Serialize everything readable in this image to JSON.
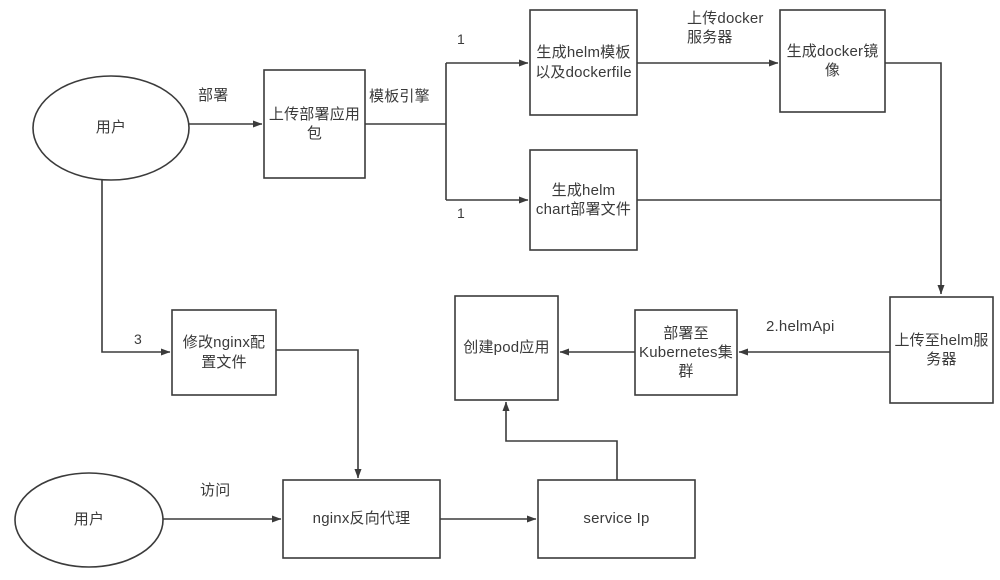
{
  "diagram": {
    "title": "Helm/Docker deployment flow",
    "stroke_color": "#3b3b3b",
    "text_color": "#3a3a3a",
    "background": "#ffffff",
    "nodes": [
      {
        "id": "user_deploy",
        "type": "ellipse",
        "label": "用户"
      },
      {
        "id": "upload_pkg",
        "type": "box",
        "label": "上传部署应用\n包"
      },
      {
        "id": "helm_tpl",
        "type": "box",
        "label": "生成helm模板\n以及dockerfile"
      },
      {
        "id": "docker_img",
        "type": "box",
        "label": "生成docker镜\n像"
      },
      {
        "id": "helm_chart",
        "type": "box",
        "label": "生成helm\nchart部署文件"
      },
      {
        "id": "helm_server",
        "type": "box",
        "label": "上传至helm服\n务器"
      },
      {
        "id": "k8s_deploy",
        "type": "box",
        "label": "部署至\nKubernetes集\n群"
      },
      {
        "id": "create_pod",
        "type": "box",
        "label": "创建pod应用"
      },
      {
        "id": "nginx_conf",
        "type": "box",
        "label": "修改nginx配\n置文件"
      },
      {
        "id": "user_access",
        "type": "ellipse",
        "label": "用户"
      },
      {
        "id": "nginx_proxy",
        "type": "box",
        "label": "nginx反向代理"
      },
      {
        "id": "service_ip",
        "type": "box",
        "label": "service Ip"
      }
    ],
    "edges": [
      {
        "id": "e_deploy",
        "from": "user_deploy",
        "to": "upload_pkg",
        "label": "部署"
      },
      {
        "id": "e_tplengine",
        "from": "upload_pkg",
        "to": "split",
        "label": "模板引擎"
      },
      {
        "id": "e_branch_top",
        "from": "split",
        "to": "helm_tpl",
        "label": "1"
      },
      {
        "id": "e_branch_bot",
        "from": "split",
        "to": "helm_chart",
        "label": "1"
      },
      {
        "id": "e_docker_up",
        "from": "helm_tpl",
        "to": "docker_img",
        "label": "上传docker\n服务器"
      },
      {
        "id": "e_img_to_helm",
        "from": "docker_img",
        "to": "helm_server",
        "label": ""
      },
      {
        "id": "e_chart_to_helm",
        "from": "helm_chart",
        "to": "helm_server",
        "label": ""
      },
      {
        "id": "e_helmapi",
        "from": "helm_server",
        "to": "k8s_deploy",
        "label": "2.helmApi"
      },
      {
        "id": "e_k8s_pod",
        "from": "k8s_deploy",
        "to": "create_pod",
        "label": ""
      },
      {
        "id": "e_user_nginx",
        "from": "user_deploy",
        "to": "nginx_conf",
        "label": "3"
      },
      {
        "id": "e_conf_proxy",
        "from": "nginx_conf",
        "to": "nginx_proxy",
        "label": ""
      },
      {
        "id": "e_access",
        "from": "user_access",
        "to": "nginx_proxy",
        "label": "访问"
      },
      {
        "id": "e_proxy_svc",
        "from": "nginx_proxy",
        "to": "service_ip",
        "label": ""
      },
      {
        "id": "e_svc_pod",
        "from": "service_ip",
        "to": "create_pod",
        "label": ""
      }
    ]
  },
  "labels": {
    "user_deploy": "用户",
    "upload_pkg": "上传部署应用\n包",
    "helm_tpl": "生成helm模板\n以及dockerfile",
    "docker_img": "生成docker镜\n像",
    "helm_chart": "生成helm\nchart部署文件",
    "helm_server": "上传至helm服\n务器",
    "k8s_deploy": "部署至\nKubernetes集\n群",
    "create_pod": "创建pod应用",
    "nginx_conf": "修改nginx配\n置文件",
    "user_access": "用户",
    "nginx_proxy": "nginx反向代理",
    "service_ip": "service Ip"
  },
  "edge_labels": {
    "deploy": "部署",
    "template_engine": "模板引擎",
    "branch_top_num": "1",
    "branch_bottom_num": "1",
    "upload_docker_server": "上传docker\n服务器",
    "helm_api": "2.helmApi",
    "step_three": "3",
    "access": "访问"
  }
}
